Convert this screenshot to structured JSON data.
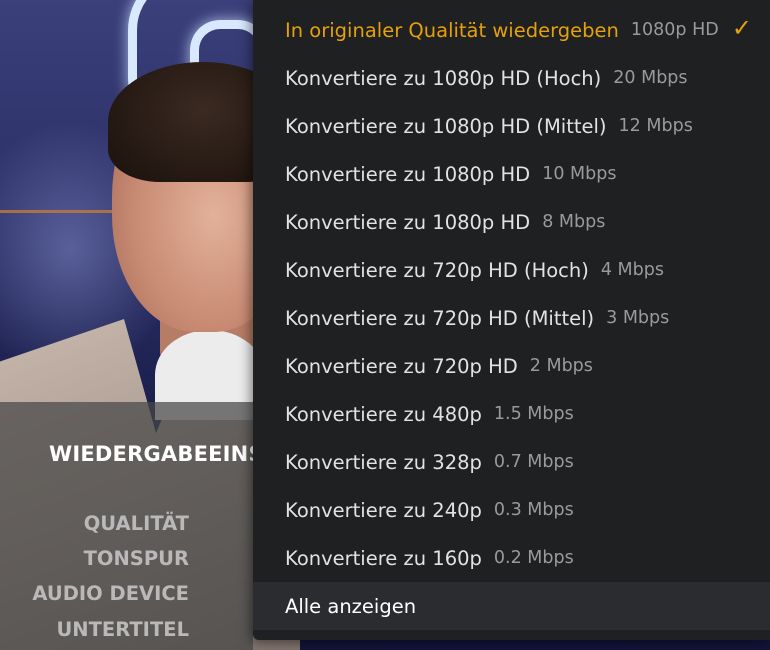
{
  "settings": {
    "title": "WIEDERGABEEINS",
    "labels": [
      "QUALITÄT",
      "TONSPUR",
      "AUDIO DEVICE",
      "UNTERTITEL"
    ]
  },
  "quality_menu": {
    "items": [
      {
        "label": "In originaler Qualität wiedergeben",
        "rate": "1080p HD",
        "selected": true
      },
      {
        "label": "Konvertiere zu 1080p HD (Hoch)",
        "rate": "20 Mbps"
      },
      {
        "label": "Konvertiere zu 1080p HD (Mittel)",
        "rate": "12 Mbps"
      },
      {
        "label": "Konvertiere zu 1080p HD",
        "rate": "10 Mbps"
      },
      {
        "label": "Konvertiere zu 1080p HD",
        "rate": "8 Mbps"
      },
      {
        "label": "Konvertiere zu 720p HD (Hoch)",
        "rate": "4 Mbps"
      },
      {
        "label": "Konvertiere zu 720p HD (Mittel)",
        "rate": "3 Mbps"
      },
      {
        "label": "Konvertiere zu 720p HD",
        "rate": "2 Mbps"
      },
      {
        "label": "Konvertiere zu 480p",
        "rate": "1.5 Mbps"
      },
      {
        "label": "Konvertiere zu 328p",
        "rate": "0.7 Mbps"
      },
      {
        "label": "Konvertiere zu 240p",
        "rate": "0.3 Mbps"
      },
      {
        "label": "Konvertiere zu 160p",
        "rate": "0.2 Mbps"
      }
    ],
    "show_all_label": "Alle anzeigen",
    "check_icon": "checkmark-icon"
  },
  "colors": {
    "accent": "#e5a00d",
    "menu_bg": "#1f2022",
    "menu_text": "#e2e2e2",
    "rate_text": "#9a9a9a"
  }
}
